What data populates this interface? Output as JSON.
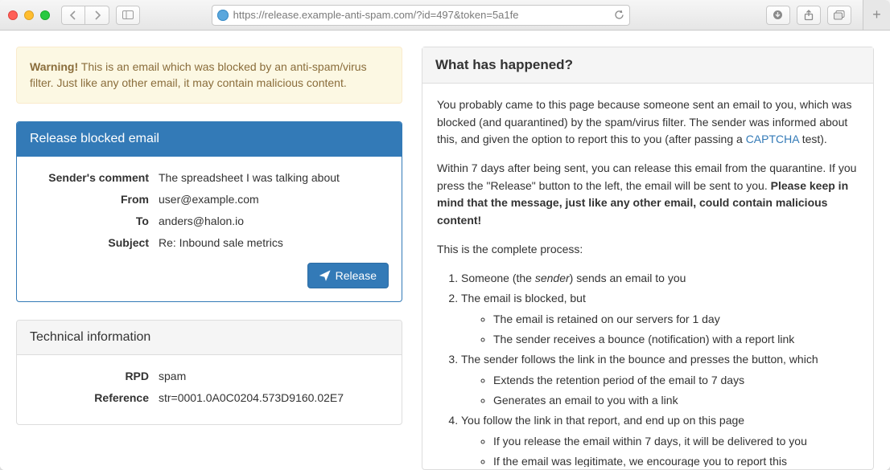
{
  "browser": {
    "url": "https://release.example-anti-spam.com/?id=497&token=5a1fe"
  },
  "alert": {
    "strong": "Warning!",
    "text": " This is an email which was blocked by an anti-spam/virus filter. Just like any other email, it may contain malicious content."
  },
  "release_panel": {
    "title": "Release blocked email",
    "fields": {
      "sender_comment_label": "Sender's comment",
      "sender_comment": "The spreadsheet I was talking about",
      "from_label": "From",
      "from": "user@example.com",
      "to_label": "To",
      "to": "anders@halon.io",
      "subject_label": "Subject",
      "subject": "Re: Inbound sale metrics"
    },
    "button": "Release"
  },
  "tech_panel": {
    "title": "Technical information",
    "fields": {
      "rpd_label": "RPD",
      "rpd": "spam",
      "reference_label": "Reference",
      "reference": "str=0001.0A0C0204.573D9160.02E7"
    }
  },
  "info": {
    "title": "What has happened?",
    "p1a": "You probably came to this page because someone sent an email to you, which was blocked (and quarantined) by the spam/virus filter. The sender was informed about this, and given the option to report this to you (after passing a ",
    "captcha": "CAPTCHA",
    "p1b": " test).",
    "p2a": "Within 7 days after being sent, you can release this email from the quarantine. If you press the \"Release\" button to the left, the email will be sent to you. ",
    "p2b": "Please keep in mind that the message, just like any other email, could contain malicious content!",
    "p3": "This is the complete process:",
    "steps": {
      "s1a": "Someone (the ",
      "s1em": "sender",
      "s1b": ") sends an email to you",
      "s2": "The email is blocked, but",
      "s2a": "The email is retained on our servers for 1 day",
      "s2b": "The sender receives a bounce (notification) with a report link",
      "s3": "The sender follows the link in the bounce and presses the button, which",
      "s3a": "Extends the retention period of the email to 7 days",
      "s3b": "Generates an email to you with a link",
      "s4": "You follow the link in that report, and end up on this page",
      "s4a": "If you release the email within 7 days, it will be delivered to you",
      "s4b": "If the email was legitimate, we encourage you to report this"
    }
  }
}
